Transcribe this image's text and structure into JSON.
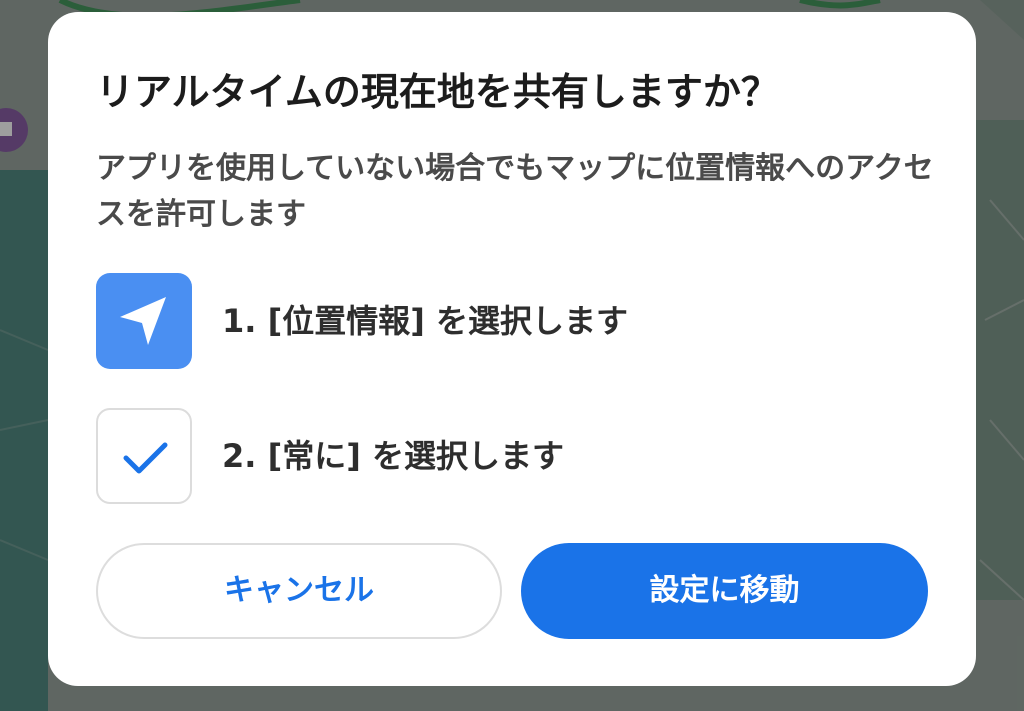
{
  "colors": {
    "accent": "#1a73e8",
    "icon_box": "#4a8ff2",
    "title_text": "#1c1c1c",
    "body_text": "#4a4a4a"
  },
  "dialog": {
    "title": "リアルタイムの現在地を共有しますか？",
    "description": "アプリを使用していない場合でもマップに位置情報へのアクセスを許可します",
    "steps": [
      {
        "icon": "location-arrow-icon",
        "label": "1. [位置情報] を選択します"
      },
      {
        "icon": "checkmark-icon",
        "label": "2. [常に] を選択します"
      }
    ],
    "buttons": {
      "cancel": "キャンセル",
      "go_to_settings": "設定に移動"
    }
  }
}
